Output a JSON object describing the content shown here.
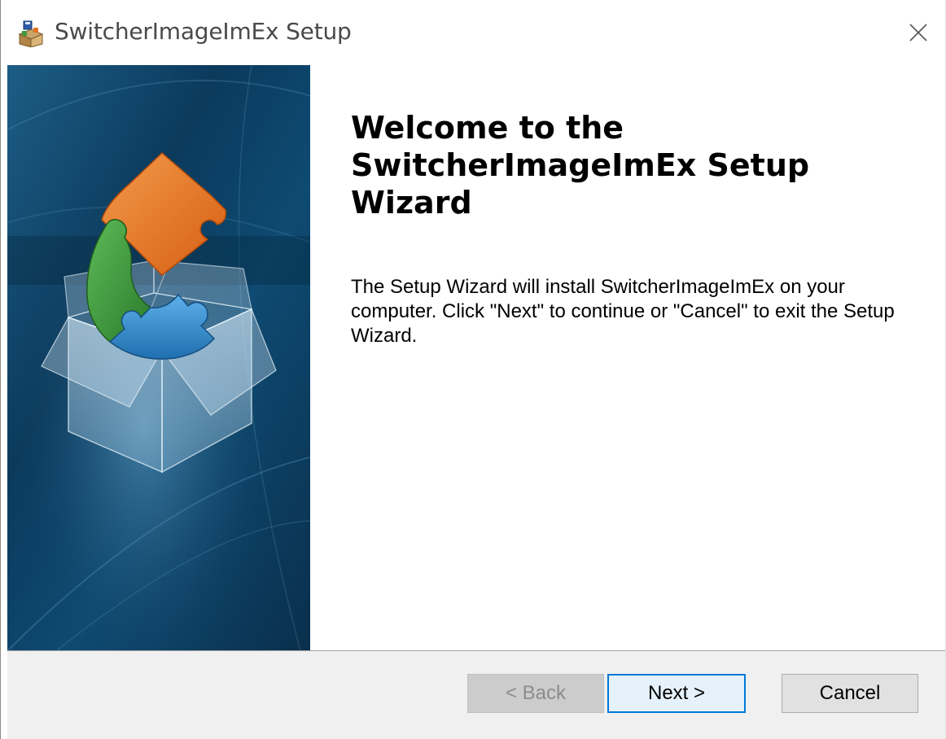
{
  "window": {
    "title": "SwitcherImageImEx Setup",
    "icons": {
      "app": "installer-icon",
      "close": "close-icon"
    }
  },
  "banner": {
    "image": "puzzle-box-graphic",
    "colors": {
      "background": "#0b3a5c",
      "orange": "#e8731f",
      "green": "#3f9a3c",
      "blue": "#2f86c8"
    }
  },
  "content": {
    "title": "Welcome to the SwitcherImageImEx Setup Wizard",
    "body": "The Setup Wizard will install SwitcherImageImEx on your computer.  Click \"Next\" to continue or \"Cancel\" to exit the Setup Wizard."
  },
  "buttons": {
    "back": "< Back",
    "next": "Next >",
    "cancel": "Cancel"
  },
  "colors": {
    "accent": "#0078d7",
    "footer": "#f0f0f0",
    "disabled_text": "#8c8c8c"
  }
}
